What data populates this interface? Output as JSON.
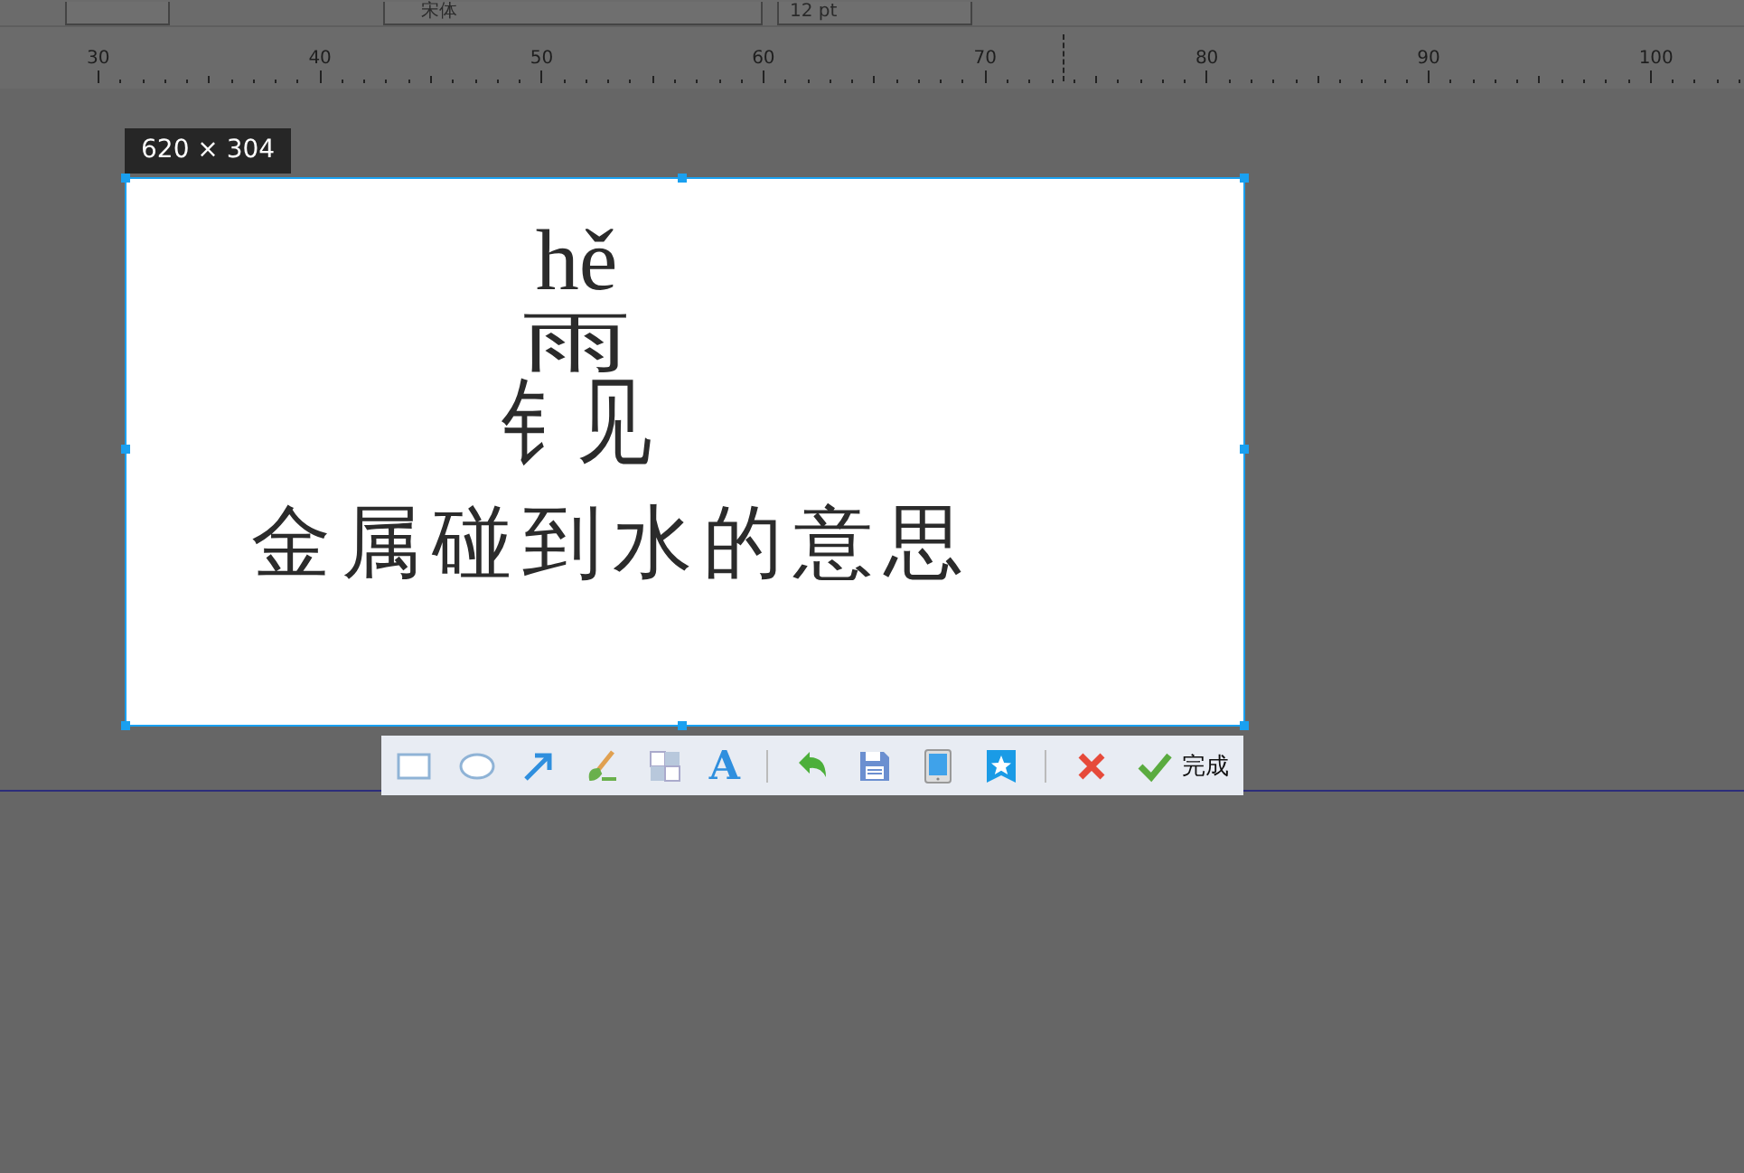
{
  "ribbon": {
    "font_name": "宋体",
    "font_size": "12 pt"
  },
  "ruler": {
    "labels": [
      "30",
      "40",
      "50",
      "60",
      "70",
      "80",
      "90",
      "100"
    ]
  },
  "capture": {
    "size_label": "620 × 304",
    "content": {
      "pinyin": "hě",
      "character_parts": [
        "雨",
        "钅",
        "见"
      ],
      "meaning": "金属碰到水的意思"
    }
  },
  "toolbar": {
    "text_tool_glyph": "A",
    "done_label": "完成"
  }
}
